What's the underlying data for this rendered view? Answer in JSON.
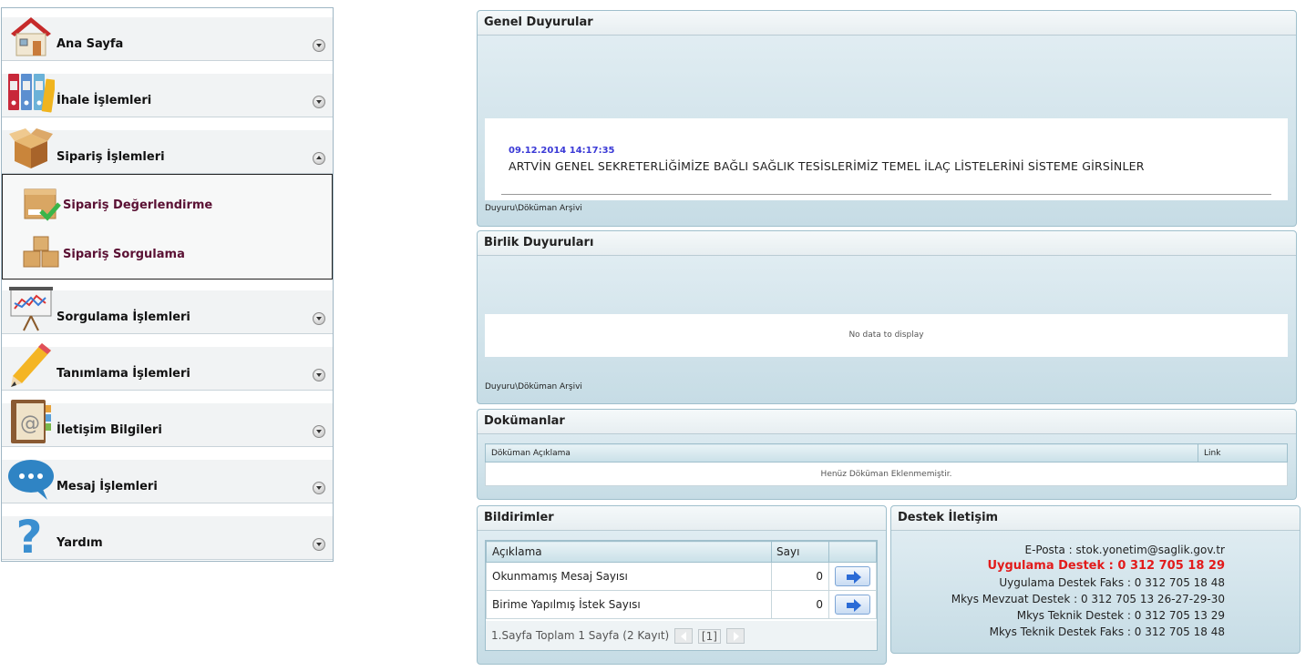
{
  "sidebar": {
    "items": [
      {
        "label": "Ana Sayfa",
        "icon": "house-icon"
      },
      {
        "label": "İhale İşlemleri",
        "icon": "binders-icon"
      },
      {
        "label": "Sipariş İşlemleri",
        "icon": "open-box-icon",
        "expanded": true
      },
      {
        "label": "Sorgulama İşlemleri",
        "icon": "chart-easel-icon"
      },
      {
        "label": "Tanımlama İşlemleri",
        "icon": "pencil-icon"
      },
      {
        "label": "İletişim Bilgileri",
        "icon": "address-book-icon"
      },
      {
        "label": "Mesaj İşlemleri",
        "icon": "speech-bubble-icon"
      },
      {
        "label": "Yardım",
        "icon": "question-mark-icon"
      }
    ],
    "subitems": [
      {
        "label": "Sipariş Değerlendirme",
        "icon": "box-check-icon"
      },
      {
        "label": "Sipariş Sorgulama",
        "icon": "boxes-icon"
      }
    ]
  },
  "genel": {
    "title": "Genel Duyurular",
    "date": "09.12.2014 14:17:35",
    "text": "ARTVİN GENEL SEKRETERLİĞİMİZE BAĞLI SAĞLIK TESİSLERİMİZ TEMEL İLAÇ LİSTELERİNİ SİSTEME GİRSİNLER",
    "archive": "Duyuru\\Döküman Arşivi"
  },
  "birlik": {
    "title": "Birlik Duyuruları",
    "empty": "No data to display",
    "archive": "Duyuru\\Döküman Arşivi"
  },
  "dokumanlar": {
    "title": "Dokümanlar",
    "col_desc": "Döküman Açıklama",
    "col_link": "Link",
    "empty": "Henüz Döküman Eklenmemiştir."
  },
  "bildirimler": {
    "title": "Bildirimler",
    "col_desc": "Açıklama",
    "col_count": "Sayı",
    "rows": [
      {
        "desc": "Okunmamış Mesaj Sayısı",
        "count": "0"
      },
      {
        "desc": "Birime Yapılmış İstek Sayısı",
        "count": "0"
      }
    ],
    "pager_text": "1.Sayfa Toplam 1 Sayfa (2 Kayıt)",
    "page_label": "[1]"
  },
  "destek": {
    "title": "Destek İletişim",
    "email": "E-Posta : stok.yonetim@saglik.gov.tr",
    "app_support": "Uygulama Destek : 0 312 705 18 29",
    "app_fax": "Uygulama Destek Faks : 0 312 705 18 48",
    "law_support": "Mkys Mevzuat Destek : 0 312 705 13 26-27-29-30",
    "tech_support": "Mkys Teknik Destek : 0 312 705 13 29",
    "tech_fax": "Mkys Teknik Destek Faks : 0 312 705 18 48"
  },
  "colors": {
    "accent_red": "#e21b1b",
    "date_blue": "#3a39d6",
    "sub_label": "#5a1033"
  }
}
